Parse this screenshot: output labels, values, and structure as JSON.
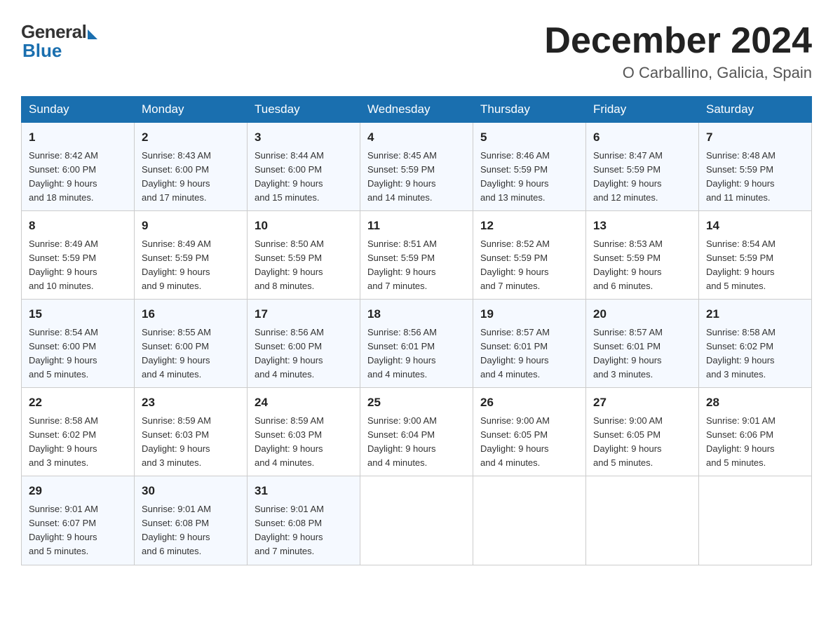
{
  "header": {
    "logo_general": "General",
    "logo_blue": "Blue",
    "month_title": "December 2024",
    "location": "O Carballino, Galicia, Spain"
  },
  "weekdays": [
    "Sunday",
    "Monday",
    "Tuesday",
    "Wednesday",
    "Thursday",
    "Friday",
    "Saturday"
  ],
  "weeks": [
    [
      {
        "day": "1",
        "sunrise": "8:42 AM",
        "sunset": "6:00 PM",
        "daylight": "9 hours and 18 minutes."
      },
      {
        "day": "2",
        "sunrise": "8:43 AM",
        "sunset": "6:00 PM",
        "daylight": "9 hours and 17 minutes."
      },
      {
        "day": "3",
        "sunrise": "8:44 AM",
        "sunset": "6:00 PM",
        "daylight": "9 hours and 15 minutes."
      },
      {
        "day": "4",
        "sunrise": "8:45 AM",
        "sunset": "5:59 PM",
        "daylight": "9 hours and 14 minutes."
      },
      {
        "day": "5",
        "sunrise": "8:46 AM",
        "sunset": "5:59 PM",
        "daylight": "9 hours and 13 minutes."
      },
      {
        "day": "6",
        "sunrise": "8:47 AM",
        "sunset": "5:59 PM",
        "daylight": "9 hours and 12 minutes."
      },
      {
        "day": "7",
        "sunrise": "8:48 AM",
        "sunset": "5:59 PM",
        "daylight": "9 hours and 11 minutes."
      }
    ],
    [
      {
        "day": "8",
        "sunrise": "8:49 AM",
        "sunset": "5:59 PM",
        "daylight": "9 hours and 10 minutes."
      },
      {
        "day": "9",
        "sunrise": "8:49 AM",
        "sunset": "5:59 PM",
        "daylight": "9 hours and 9 minutes."
      },
      {
        "day": "10",
        "sunrise": "8:50 AM",
        "sunset": "5:59 PM",
        "daylight": "9 hours and 8 minutes."
      },
      {
        "day": "11",
        "sunrise": "8:51 AM",
        "sunset": "5:59 PM",
        "daylight": "9 hours and 7 minutes."
      },
      {
        "day": "12",
        "sunrise": "8:52 AM",
        "sunset": "5:59 PM",
        "daylight": "9 hours and 7 minutes."
      },
      {
        "day": "13",
        "sunrise": "8:53 AM",
        "sunset": "5:59 PM",
        "daylight": "9 hours and 6 minutes."
      },
      {
        "day": "14",
        "sunrise": "8:54 AM",
        "sunset": "5:59 PM",
        "daylight": "9 hours and 5 minutes."
      }
    ],
    [
      {
        "day": "15",
        "sunrise": "8:54 AM",
        "sunset": "6:00 PM",
        "daylight": "9 hours and 5 minutes."
      },
      {
        "day": "16",
        "sunrise": "8:55 AM",
        "sunset": "6:00 PM",
        "daylight": "9 hours and 4 minutes."
      },
      {
        "day": "17",
        "sunrise": "8:56 AM",
        "sunset": "6:00 PM",
        "daylight": "9 hours and 4 minutes."
      },
      {
        "day": "18",
        "sunrise": "8:56 AM",
        "sunset": "6:01 PM",
        "daylight": "9 hours and 4 minutes."
      },
      {
        "day": "19",
        "sunrise": "8:57 AM",
        "sunset": "6:01 PM",
        "daylight": "9 hours and 4 minutes."
      },
      {
        "day": "20",
        "sunrise": "8:57 AM",
        "sunset": "6:01 PM",
        "daylight": "9 hours and 3 minutes."
      },
      {
        "day": "21",
        "sunrise": "8:58 AM",
        "sunset": "6:02 PM",
        "daylight": "9 hours and 3 minutes."
      }
    ],
    [
      {
        "day": "22",
        "sunrise": "8:58 AM",
        "sunset": "6:02 PM",
        "daylight": "9 hours and 3 minutes."
      },
      {
        "day": "23",
        "sunrise": "8:59 AM",
        "sunset": "6:03 PM",
        "daylight": "9 hours and 3 minutes."
      },
      {
        "day": "24",
        "sunrise": "8:59 AM",
        "sunset": "6:03 PM",
        "daylight": "9 hours and 4 minutes."
      },
      {
        "day": "25",
        "sunrise": "9:00 AM",
        "sunset": "6:04 PM",
        "daylight": "9 hours and 4 minutes."
      },
      {
        "day": "26",
        "sunrise": "9:00 AM",
        "sunset": "6:05 PM",
        "daylight": "9 hours and 4 minutes."
      },
      {
        "day": "27",
        "sunrise": "9:00 AM",
        "sunset": "6:05 PM",
        "daylight": "9 hours and 5 minutes."
      },
      {
        "day": "28",
        "sunrise": "9:01 AM",
        "sunset": "6:06 PM",
        "daylight": "9 hours and 5 minutes."
      }
    ],
    [
      {
        "day": "29",
        "sunrise": "9:01 AM",
        "sunset": "6:07 PM",
        "daylight": "9 hours and 5 minutes."
      },
      {
        "day": "30",
        "sunrise": "9:01 AM",
        "sunset": "6:08 PM",
        "daylight": "9 hours and 6 minutes."
      },
      {
        "day": "31",
        "sunrise": "9:01 AM",
        "sunset": "6:08 PM",
        "daylight": "9 hours and 7 minutes."
      },
      null,
      null,
      null,
      null
    ]
  ],
  "labels": {
    "sunrise_prefix": "Sunrise: ",
    "sunset_prefix": "Sunset: ",
    "daylight_prefix": "Daylight: "
  }
}
